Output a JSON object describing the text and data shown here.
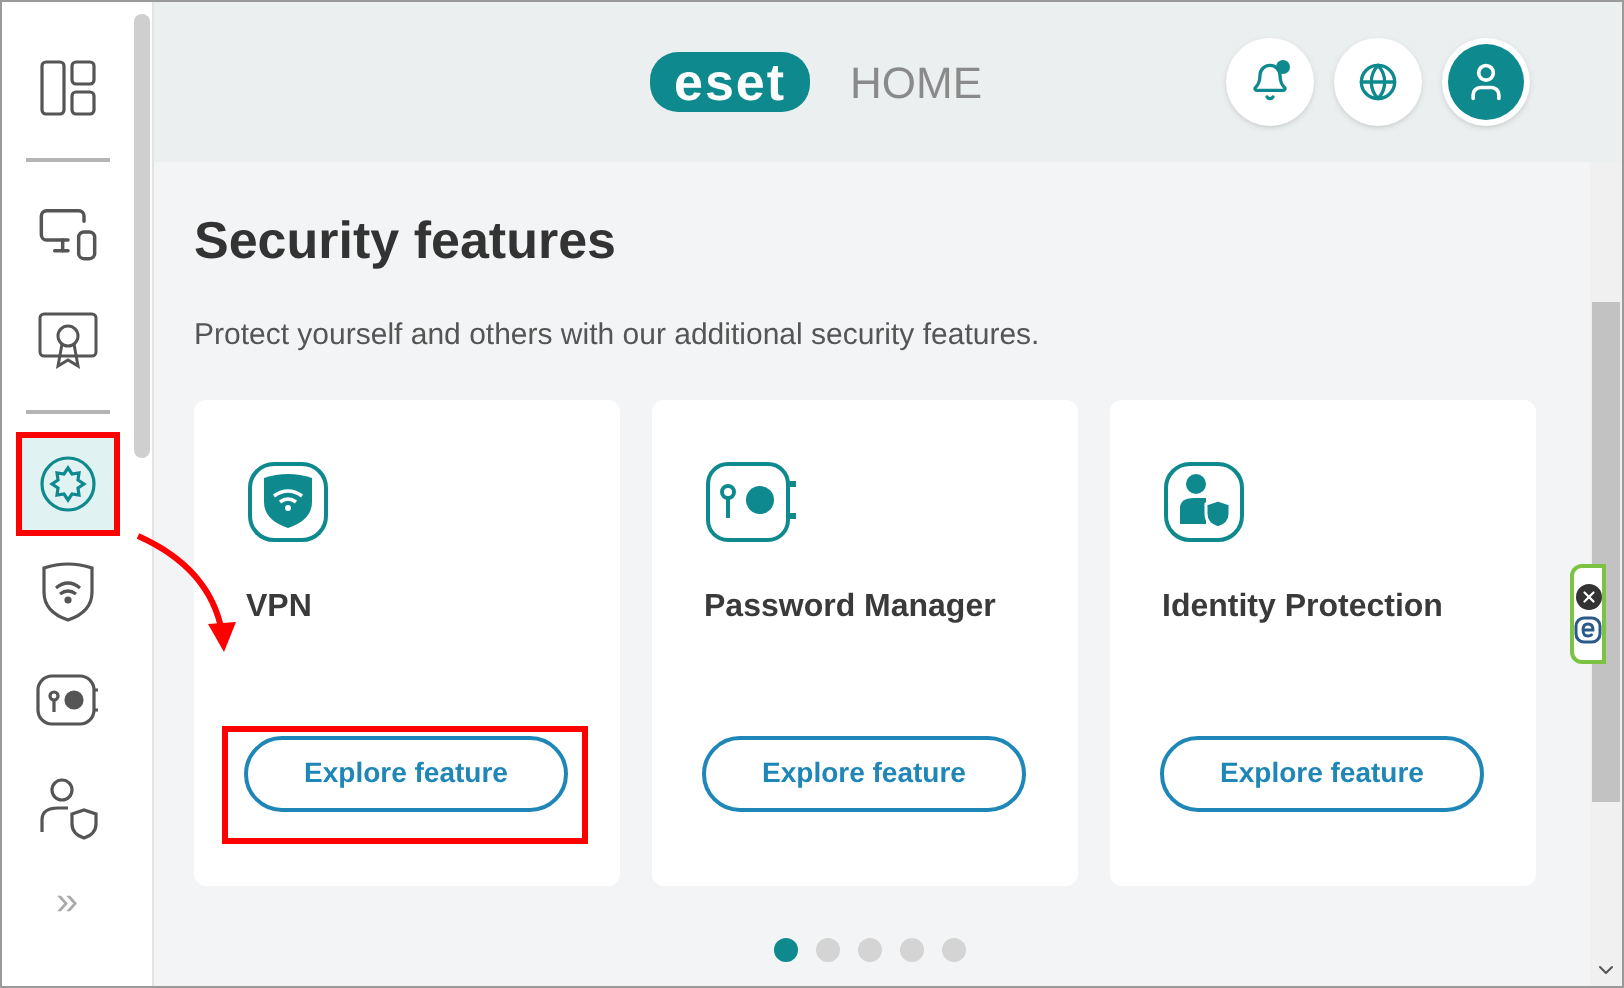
{
  "sidebar": {
    "items": [
      {
        "kind": "dashboard",
        "selected": false
      },
      {
        "kind": "divider"
      },
      {
        "kind": "devices",
        "selected": false
      },
      {
        "kind": "license",
        "selected": false
      },
      {
        "kind": "divider"
      },
      {
        "kind": "security",
        "selected": true
      },
      {
        "kind": "vpn",
        "selected": false
      },
      {
        "kind": "password",
        "selected": false
      },
      {
        "kind": "identity",
        "selected": false
      },
      {
        "kind": "expand",
        "label": "»"
      }
    ]
  },
  "header": {
    "logo": "eset",
    "product": "HOME",
    "notification_unread": true
  },
  "section": {
    "title": "Security features",
    "description": "Protect yourself and others with our additional security features."
  },
  "cards": [
    {
      "kind": "vpn",
      "title": "VPN",
      "button": "Explore feature",
      "highlighted": true
    },
    {
      "kind": "password",
      "title": "Password Manager",
      "button": "Explore feature",
      "highlighted": false
    },
    {
      "kind": "identity",
      "title": "Identity Protection",
      "button": "Explore feature",
      "highlighted": false
    }
  ],
  "pagination": [
    {
      "selected": true
    },
    {
      "selected": false
    },
    {
      "selected": false
    },
    {
      "selected": false
    },
    {
      "selected": false
    }
  ]
}
